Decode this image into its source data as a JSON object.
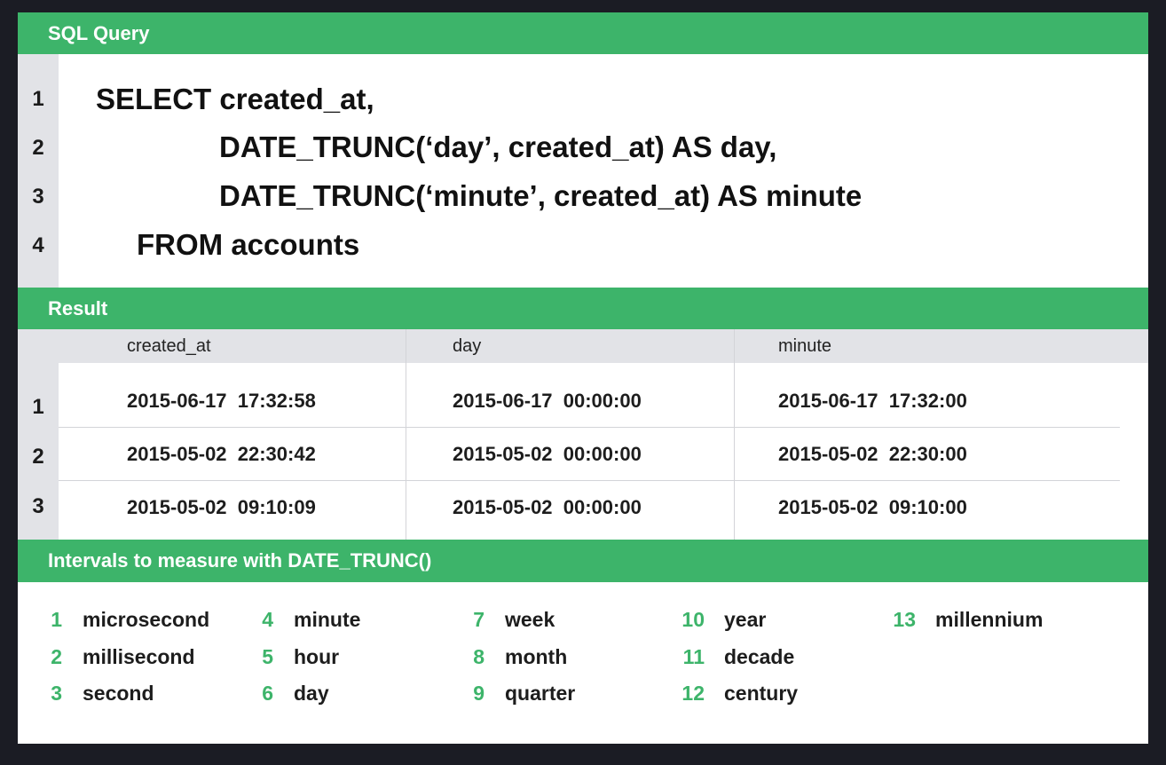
{
  "sql": {
    "title": "SQL Query",
    "lines": [
      {
        "num": "1",
        "text": "SELECT created_at,"
      },
      {
        "num": "2",
        "text": "DATE_TRUNC(‘day’, created_at) AS day,"
      },
      {
        "num": "3",
        "text": "DATE_TRUNC(‘minute’, created_at) AS minute"
      },
      {
        "num": "4",
        "text": "FROM accounts"
      }
    ]
  },
  "result": {
    "title": "Result",
    "columns": [
      "created_at",
      "day",
      "minute"
    ],
    "rows": [
      {
        "num": "1",
        "cells": [
          "2015-06-17  17:32:58",
          "2015-06-17  00:00:00",
          "2015-06-17  17:32:00"
        ]
      },
      {
        "num": "2",
        "cells": [
          "2015-05-02  22:30:42",
          "2015-05-02  00:00:00",
          "2015-05-02  22:30:00"
        ]
      },
      {
        "num": "3",
        "cells": [
          "2015-05-02  09:10:09",
          "2015-05-02  00:00:00",
          "2015-05-02  09:10:00"
        ]
      }
    ]
  },
  "intervals": {
    "title": "Intervals to measure with DATE_TRUNC()",
    "items": [
      {
        "num": "1",
        "label": "microsecond"
      },
      {
        "num": "2",
        "label": "millisecond"
      },
      {
        "num": "3",
        "label": "second"
      },
      {
        "num": "4",
        "label": "minute"
      },
      {
        "num": "5",
        "label": "hour"
      },
      {
        "num": "6",
        "label": "day"
      },
      {
        "num": "7",
        "label": "week"
      },
      {
        "num": "8",
        "label": "month"
      },
      {
        "num": "9",
        "label": "quarter"
      },
      {
        "num": "10",
        "label": "year"
      },
      {
        "num": "11",
        "label": "decade"
      },
      {
        "num": "12",
        "label": "century"
      },
      {
        "num": "13",
        "label": "millennium"
      }
    ]
  },
  "colors": {
    "accent": "#3db46a",
    "gutter": "#e2e3e7",
    "background": "#1b1c24"
  }
}
